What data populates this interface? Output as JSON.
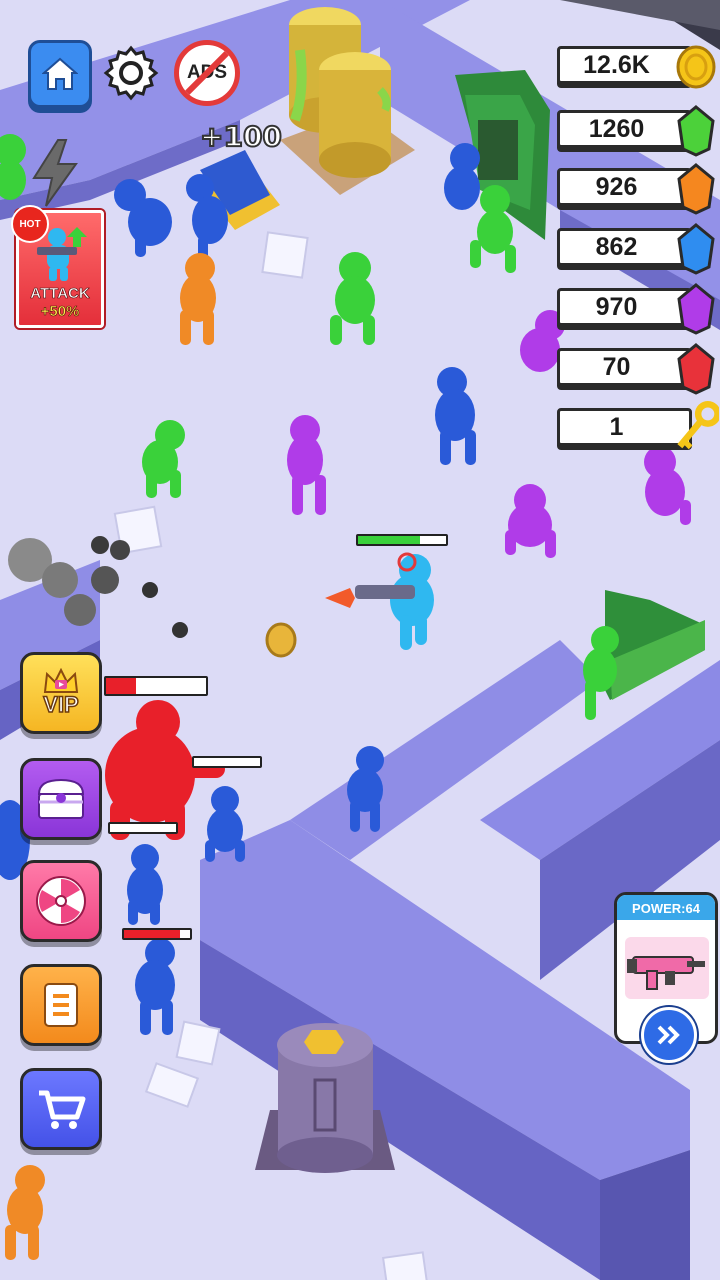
{
  "hud": {
    "floating_reward": "+100",
    "no_ads_label": "ADS"
  },
  "promo": {
    "badge": "HOT",
    "title": "ATTACK",
    "bonus": "+50%"
  },
  "currencies": [
    {
      "id": "coins",
      "value": "12.6K",
      "color": "#f5c518"
    },
    {
      "id": "green_gems",
      "value": "1260",
      "color": "#4cd13a"
    },
    {
      "id": "orange_gems",
      "value": "926",
      "color": "#f5871f"
    },
    {
      "id": "blue_gems",
      "value": "862",
      "color": "#2f8df0"
    },
    {
      "id": "purple_gems",
      "value": "970",
      "color": "#b03ce8"
    },
    {
      "id": "red_gems",
      "value": "70",
      "color": "#e8323a"
    },
    {
      "id": "keys",
      "value": "1",
      "color": "#f5c518"
    }
  ],
  "menu": {
    "vip_label": "VIP"
  },
  "power": {
    "label": "POWER:64"
  },
  "player": {
    "health_fraction": 0.7
  },
  "boss": {
    "health_fraction": 0.3
  }
}
